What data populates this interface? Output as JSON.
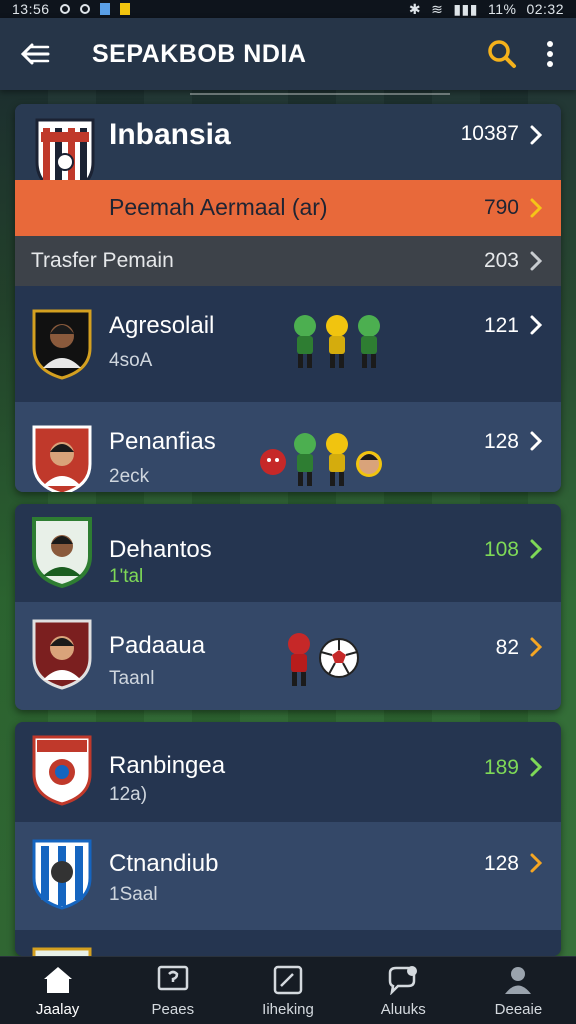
{
  "status_bar": {
    "time": "13:56",
    "battery": "11%",
    "clock": "02:32"
  },
  "app_bar": {
    "title": "SEPAKBOB NDIA"
  },
  "summary_card": {
    "title": "Inbansia",
    "title_count": "10387",
    "highlight_label": "Peemah Aermaal (ar)",
    "highlight_count": "790",
    "transfer_label": "Trasfer Pemain",
    "transfer_count": "203"
  },
  "teams_group_1": [
    {
      "name": "Agresolail",
      "sub": "4soA",
      "count": "121",
      "count_color": "#ffffff",
      "chev_color": "#ffffff"
    },
    {
      "name": "Penanfias",
      "sub": "2eck",
      "count": "128",
      "count_color": "#ffffff",
      "chev_color": "#ffffff"
    }
  ],
  "teams_group_2": [
    {
      "name": "Dehantos",
      "sub": "1'tal",
      "count": "108",
      "count_color": "#7ed957",
      "chev_color": "#7ed957"
    },
    {
      "name": "Padaaua",
      "sub": "Taanl",
      "count": "82",
      "count_color": "#ffffff",
      "chev_color": "#f5a623"
    }
  ],
  "teams_group_3": [
    {
      "name": "Ranbingea",
      "sub": "12a)",
      "count": "189",
      "count_color": "#7ed957",
      "chev_color": "#7ed957"
    },
    {
      "name": "Ctnandiub",
      "sub": "1Saal",
      "count": "128",
      "count_color": "#ffffff",
      "chev_color": "#f5a623"
    }
  ],
  "colors": {
    "accent_orange": "#e8693a",
    "accent_green": "#7ed957",
    "search_yellow": "#f5b21b"
  },
  "bottom_nav": [
    {
      "label": "Jaalay",
      "icon": "home-icon"
    },
    {
      "label": "Peaes",
      "icon": "message-icon"
    },
    {
      "label": "Iiheking",
      "icon": "edit-icon"
    },
    {
      "label": "Aluuks",
      "icon": "chat-icon"
    },
    {
      "label": "Deeaie",
      "icon": "profile-icon"
    }
  ]
}
